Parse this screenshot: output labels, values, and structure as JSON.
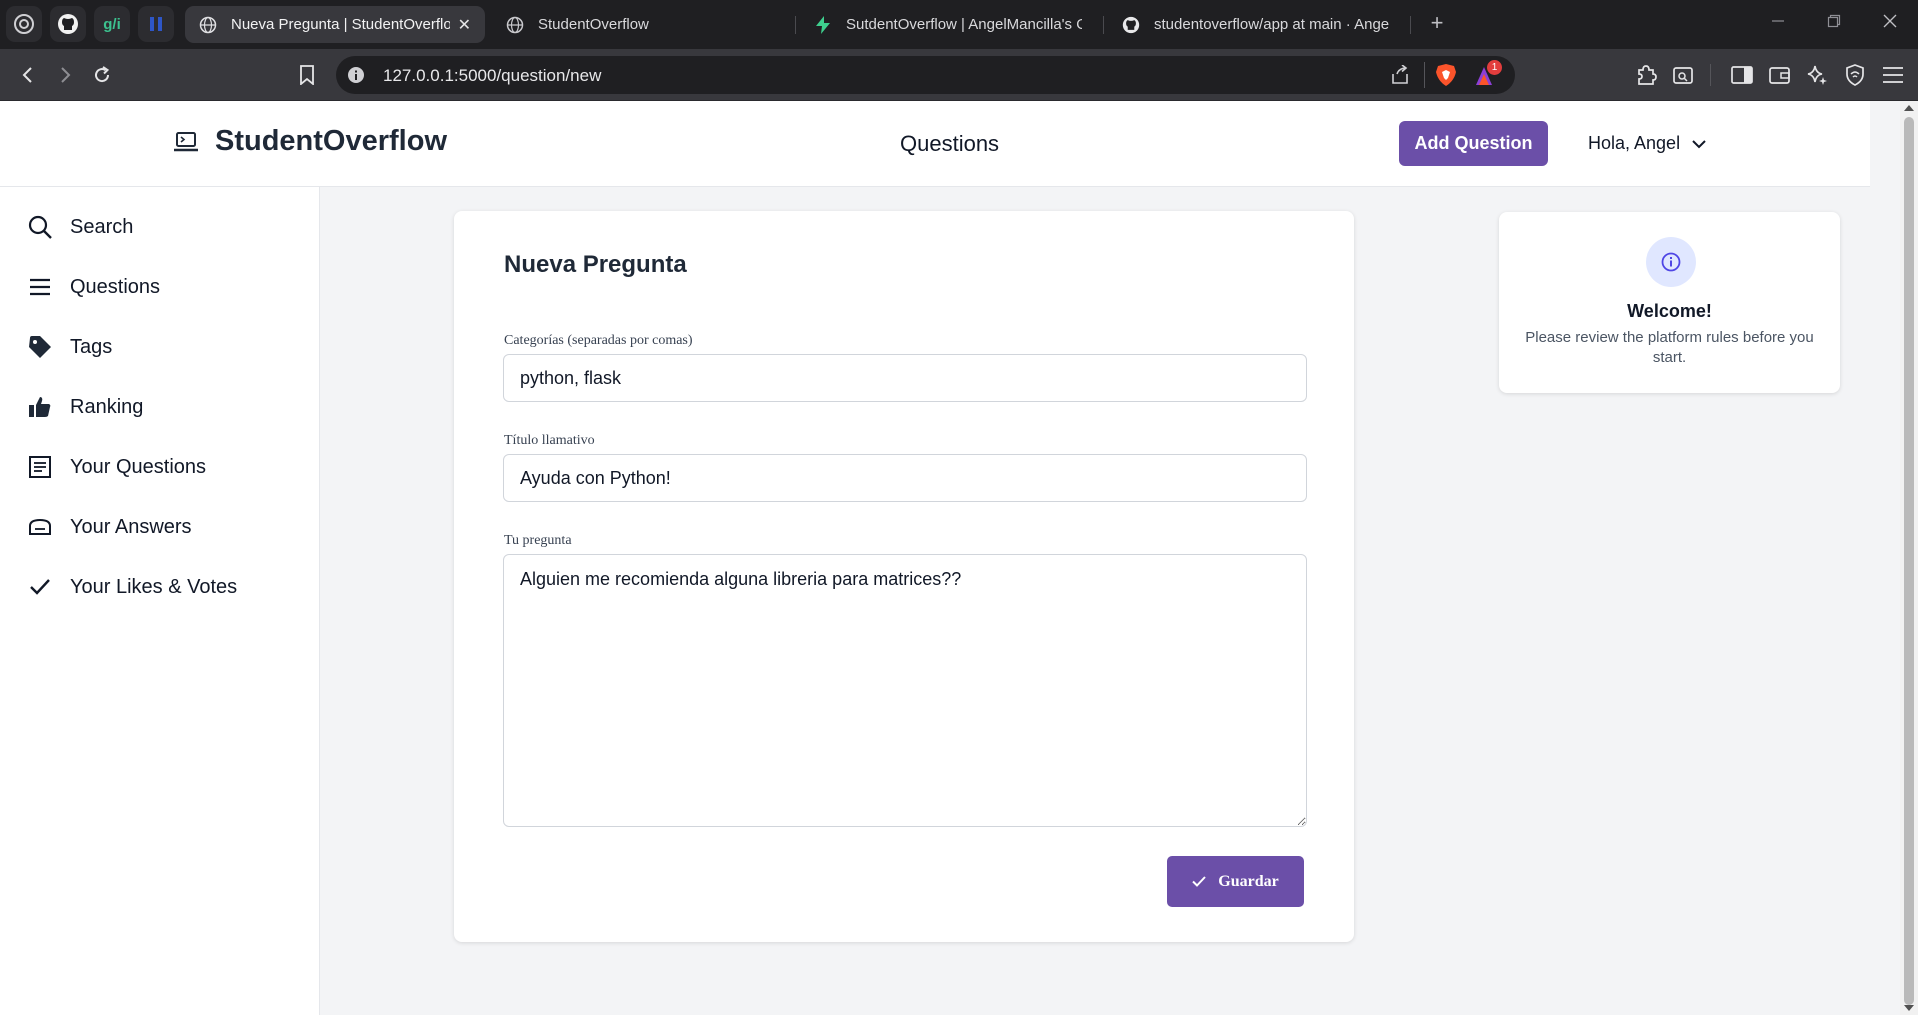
{
  "browser": {
    "pinned_tabs": [
      "openai-icon",
      "github-icon",
      "gfi-icon",
      "brand-icon"
    ],
    "pinned_gfi_label": "g/i",
    "tabs": [
      {
        "title": "Nueva Pregunta | StudentOverflow",
        "active": true
      },
      {
        "title": "StudentOverflow",
        "active": false
      },
      {
        "title": "SutdentOverflow | AngelMancilla's Org",
        "active": false
      },
      {
        "title": "studentoverflow/app at main · AngelM",
        "active": false
      }
    ],
    "new_tab_label": "+",
    "url": "127.0.0.1:5000/question/new",
    "badge_count": "1"
  },
  "header": {
    "brand": "StudentOverflow",
    "nav_label": "Questions",
    "add_question_label": "Add Question",
    "user_greeting": "Hola, Angel"
  },
  "sidebar": {
    "items": [
      {
        "label": "Search",
        "icon": "search-icon"
      },
      {
        "label": "Questions",
        "icon": "list-icon"
      },
      {
        "label": "Tags",
        "icon": "tag-icon"
      },
      {
        "label": "Ranking",
        "icon": "thumbs-up-icon"
      },
      {
        "label": "Your Questions",
        "icon": "document-icon"
      },
      {
        "label": "Your Answers",
        "icon": "chat-icon"
      },
      {
        "label": "Your Likes & Votes",
        "icon": "check-icon"
      }
    ]
  },
  "form": {
    "title": "Nueva Pregunta",
    "categories_label": "Categorías (separadas por comas)",
    "categories_value": "python, flask",
    "title_label": "Título llamativo",
    "title_value": "Ayuda con Python!",
    "question_label": "Tu pregunta",
    "question_value": "Alguien me recomienda alguna libreria para matrices??",
    "save_label": "Guardar"
  },
  "welcome": {
    "title": "Welcome!",
    "text": "Please review the platform rules before you start."
  },
  "colors": {
    "primary": "#6b4fa8",
    "chrome_dark": "#1f1f22",
    "chrome_mid": "#38383d",
    "page_bg": "#f3f4f6"
  }
}
